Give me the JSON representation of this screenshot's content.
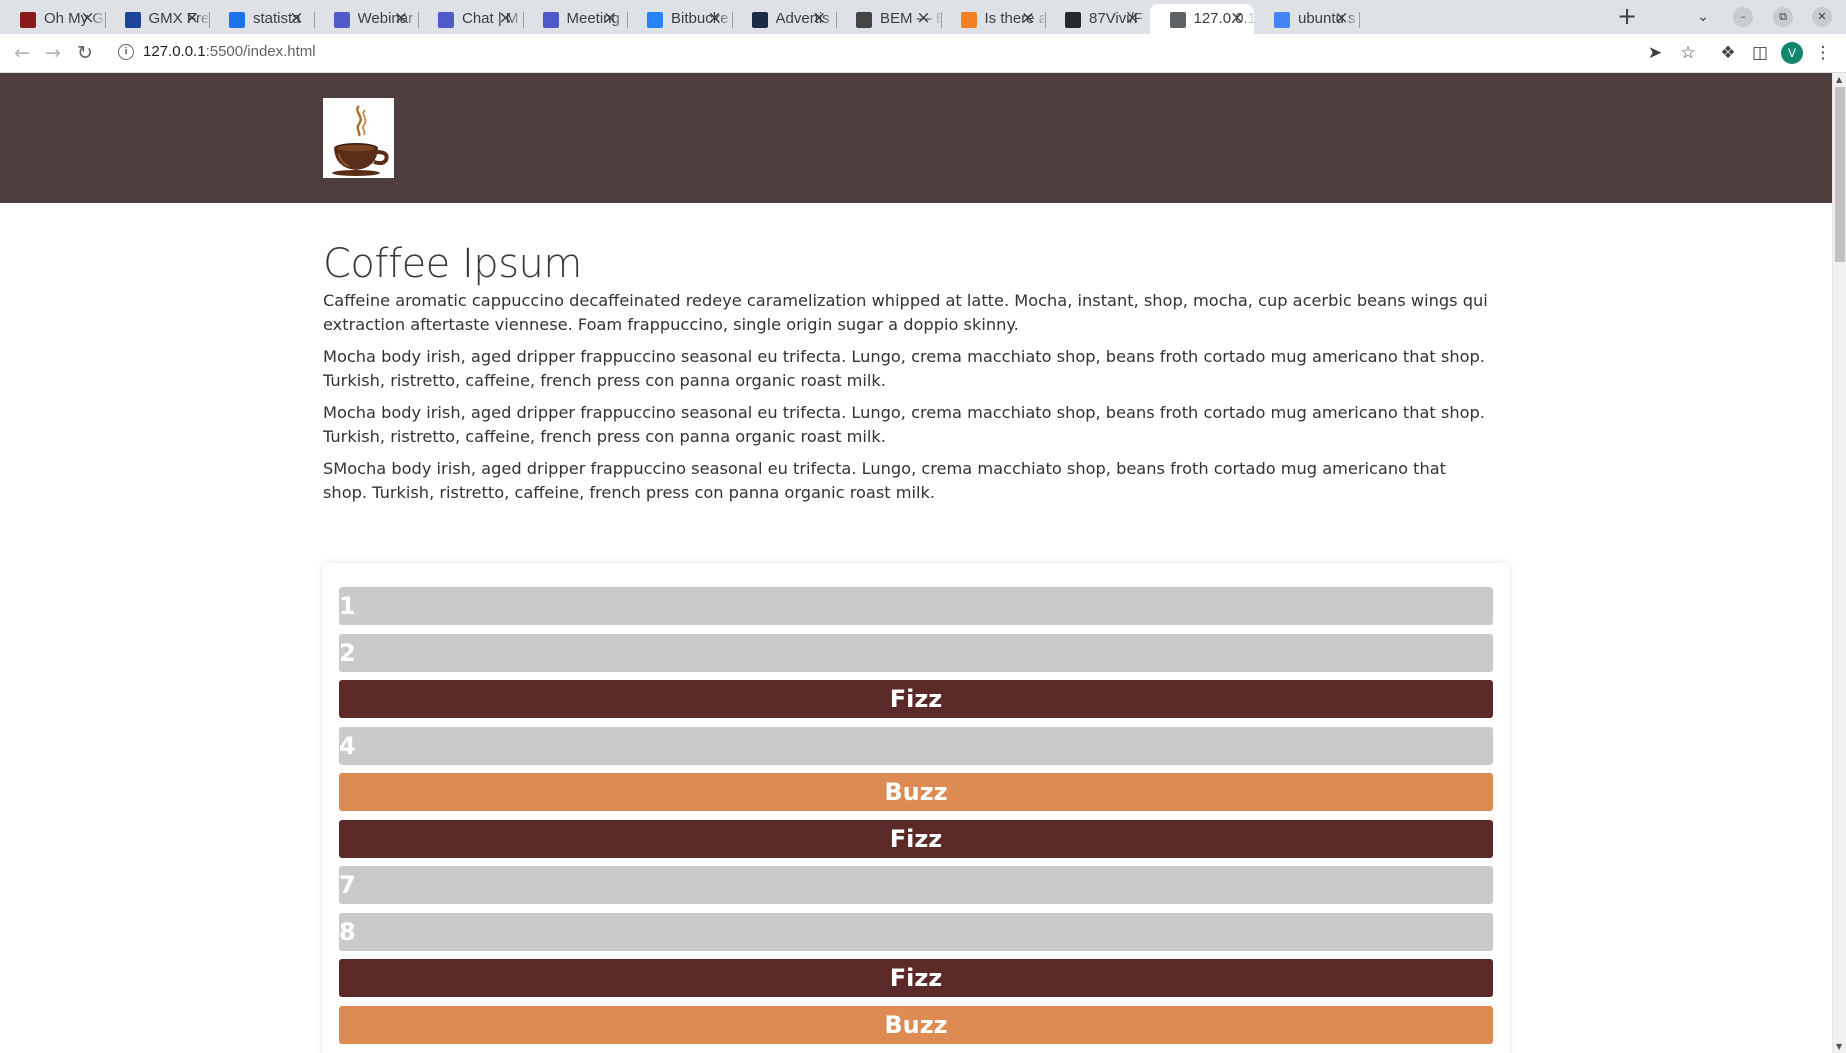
{
  "browser": {
    "tabs": [
      {
        "title": "Oh My G",
        "favicon_color": "#8b1a1a"
      },
      {
        "title": "GMX Fre",
        "favicon_color": "#1c449b"
      },
      {
        "title": "statista",
        "favicon_color": "#1a73e8"
      },
      {
        "title": "Webinar",
        "favicon_color": "#5059c9"
      },
      {
        "title": "Chat | M",
        "favicon_color": "#5059c9"
      },
      {
        "title": "Meeting",
        "favicon_color": "#5059c9"
      },
      {
        "title": "Bitbucke",
        "favicon_color": "#2684ff"
      },
      {
        "title": "Advertis",
        "favicon_color": "#1a2b44"
      },
      {
        "title": "BEM — B",
        "favicon_color": "#444444"
      },
      {
        "title": "Is there a",
        "favicon_color": "#f48024"
      },
      {
        "title": "87Vivi/F",
        "favicon_color": "#24292e"
      },
      {
        "title": "127.0.0.1",
        "favicon_color": "#5f6368"
      },
      {
        "title": "ubuntu s",
        "favicon_color": "#4285f4"
      }
    ],
    "active_tab_index": 11,
    "new_tab_label": "+",
    "url_host": "127.0.0.1",
    "url_rest": ":5500/index.html",
    "profile_initial": "V",
    "accent_profile": "#12876e"
  },
  "site": {
    "header_color": "#4d3e3d",
    "logo_name": "coffee-cup-logo",
    "title": "Coffee Ipsum",
    "paragraphs": [
      "Caffeine aromatic cappuccino decaffeinated redeye caramelization whipped at latte. Mocha, instant, shop, mocha, cup acerbic beans wings qui extraction aftertaste viennese. Foam frappuccino, single origin sugar a doppio skinny.",
      "Mocha body irish, aged dripper frappuccino seasonal eu trifecta. Lungo, crema macchiato shop, beans froth cortado mug americano that shop. Turkish, ristretto, caffeine, french press con panna organic roast milk.",
      "Mocha body irish, aged dripper frappuccino seasonal eu trifecta. Lungo, crema macchiato shop, beans froth cortado mug americano that shop. Turkish, ristretto, caffeine, french press con panna organic roast milk.",
      "SMocha body irish, aged dripper frappuccino seasonal eu trifecta. Lungo, crema macchiato shop, beans froth cortado mug americano that shop. Turkish, ristretto, caffeine, french press con panna organic roast milk."
    ],
    "fizzbuzz": [
      {
        "label": "1",
        "kind": "num"
      },
      {
        "label": "2",
        "kind": "num"
      },
      {
        "label": "Fizz",
        "kind": "fizz"
      },
      {
        "label": "4",
        "kind": "num"
      },
      {
        "label": "Buzz",
        "kind": "buzz"
      },
      {
        "label": "Fizz",
        "kind": "fizz"
      },
      {
        "label": "7",
        "kind": "num"
      },
      {
        "label": "8",
        "kind": "num"
      },
      {
        "label": "Fizz",
        "kind": "fizz"
      },
      {
        "label": "Buzz",
        "kind": "buzz"
      }
    ],
    "colors": {
      "num": "#cacaca",
      "fizz": "#5b2a28",
      "buzz": "#dd8a53"
    }
  }
}
